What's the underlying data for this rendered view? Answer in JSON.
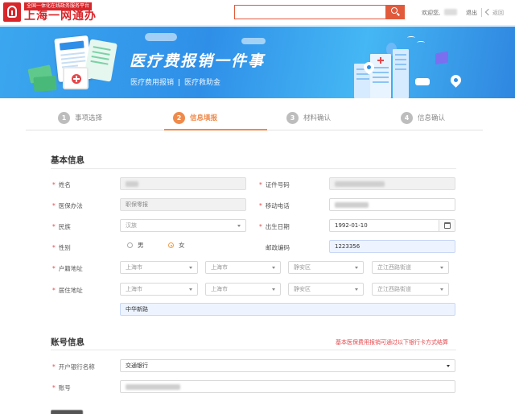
{
  "header": {
    "brand_top": "全国一体化在线政务服务平台",
    "brand_main": "上海一网通办",
    "search_placeholder": "",
    "welcome": "欢迎您,",
    "logout": "退出",
    "back": "返回"
  },
  "banner": {
    "title": "医疗费报销一件事",
    "sub1": "医疗费用报销",
    "sub2": "医疗救助金"
  },
  "steps": [
    {
      "num": "1",
      "label": "事项选择"
    },
    {
      "num": "2",
      "label": "信息填报"
    },
    {
      "num": "3",
      "label": "材料确认"
    },
    {
      "num": "4",
      "label": "信息确认"
    }
  ],
  "basic": {
    "title": "基本信息",
    "name_label": "姓名",
    "id_type_label": "证件号码",
    "insurance_label": "医保办法",
    "insurance_value": "职保零报",
    "phone_label": "移动电话",
    "ethnicity_label": "民族",
    "ethnicity_value": "汉族",
    "birth_label": "出生日期",
    "birth_value": "1992-01-10",
    "gender_label": "性别",
    "gender_male": "男",
    "gender_female": "女",
    "postcode_label": "邮政编码",
    "postcode_value": "1223356",
    "hukou_label": "户籍地址",
    "residence_label": "居住地址",
    "addr_city1": "上海市",
    "addr_city2": "上海市",
    "addr_district": "静安区",
    "addr_street": "芷江西路街道",
    "addr_detail": "中华新路"
  },
  "account": {
    "title": "账号信息",
    "note": "基本医保费用报销可通过以下银行卡方式结算",
    "bank_label": "开户银行名称",
    "bank_value": "交通银行",
    "account_label": "账号"
  },
  "colors": {
    "accent": "#f08a4b",
    "brand_red": "#d8262a",
    "banner_blue": "#2f8fe8"
  }
}
